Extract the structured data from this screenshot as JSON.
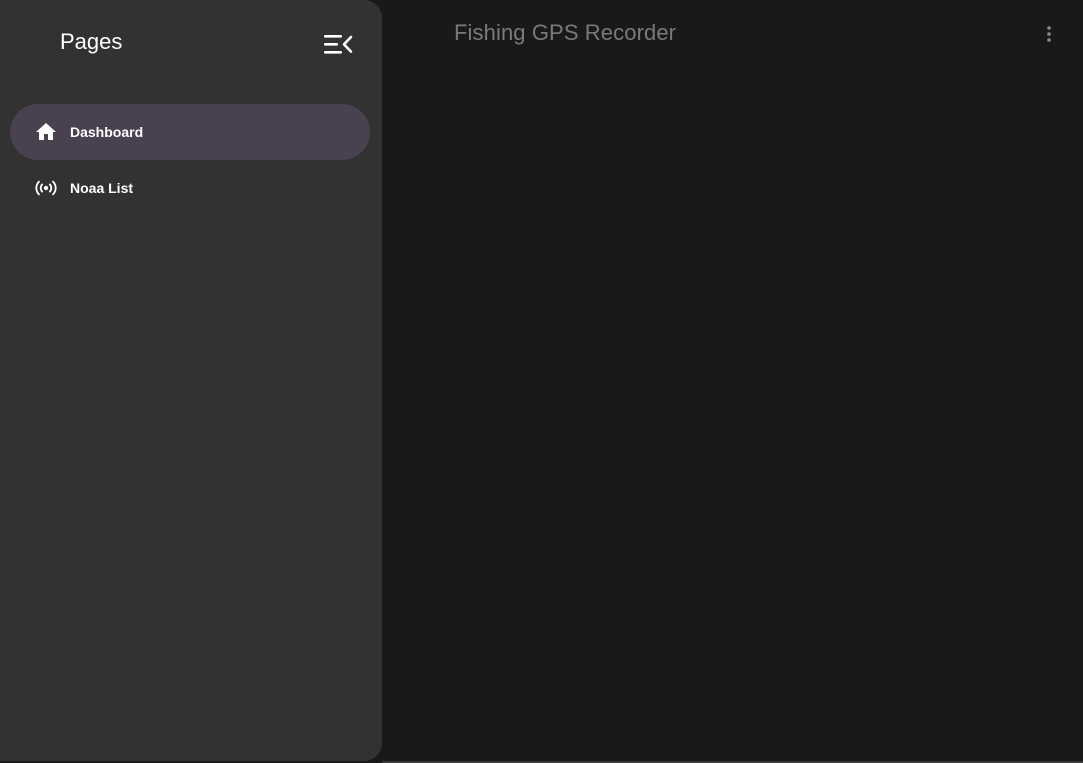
{
  "appbar": {
    "title": "Fishing GPS Recorder",
    "menu_icon": "more-vert-icon"
  },
  "drawer": {
    "title": "Pages",
    "close_icon": "menu-open-icon",
    "items": [
      {
        "label": "Dashboard",
        "icon": "home-icon",
        "active": true
      },
      {
        "label": "Noaa List",
        "icon": "broadcast-icon",
        "active": false
      }
    ]
  },
  "colors": {
    "background": "#191919",
    "drawer": "#323232",
    "active_item": "#4a4150",
    "text": "#ffffff",
    "muted_title": "#7a7a7a"
  }
}
